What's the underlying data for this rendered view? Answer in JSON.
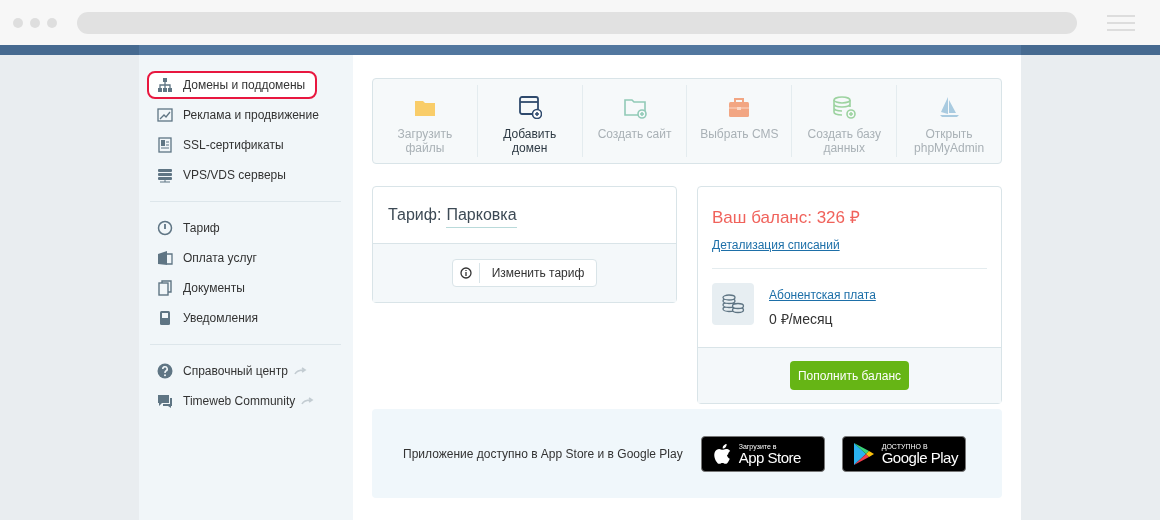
{
  "sidebar": {
    "groups": [
      {
        "items": [
          {
            "label": "Домены и поддомены",
            "kind": "sitemap",
            "selected": true,
            "highlighted": true,
            "external": false
          },
          {
            "label": "Реклама и продвижение",
            "kind": "chart",
            "selected": false,
            "highlighted": false,
            "external": false
          },
          {
            "label": "SSL-сертификаты",
            "kind": "certificate",
            "selected": false,
            "highlighted": false,
            "external": false
          },
          {
            "label": "VPS/VDS серверы",
            "kind": "server",
            "selected": false,
            "highlighted": false,
            "external": false
          }
        ]
      },
      {
        "items": [
          {
            "label": "Тариф",
            "kind": "gauge",
            "selected": false,
            "highlighted": false,
            "external": false
          },
          {
            "label": "Оплата услуг",
            "kind": "wallet",
            "selected": false,
            "highlighted": false,
            "external": false
          },
          {
            "label": "Документы",
            "kind": "documents",
            "selected": false,
            "highlighted": false,
            "external": false
          },
          {
            "label": "Уведомления",
            "kind": "phone",
            "selected": false,
            "highlighted": false,
            "external": false
          }
        ]
      },
      {
        "items": [
          {
            "label": "Справочный центр",
            "kind": "help",
            "selected": false,
            "highlighted": false,
            "external": true
          },
          {
            "label": "Timeweb Community",
            "kind": "chat",
            "selected": false,
            "highlighted": false,
            "external": true
          }
        ]
      }
    ]
  },
  "actions": [
    {
      "label": "Загрузить файлы",
      "kind": "folder",
      "disabled": true
    },
    {
      "label": "Добавить домен",
      "kind": "window",
      "disabled": false
    },
    {
      "label": "Создать сайт",
      "kind": "folderplus",
      "disabled": true
    },
    {
      "label": "Выбрать CMS",
      "kind": "briefcase",
      "disabled": true
    },
    {
      "label": "Создать базу данных",
      "kind": "database",
      "disabled": true
    },
    {
      "label": "Открыть phpMyAdmin",
      "kind": "sail",
      "disabled": true
    }
  ],
  "tariff": {
    "label": "Тариф:",
    "name": "Парковка",
    "button": "Изменить тариф"
  },
  "balance": {
    "title": "Ваш баланс: 326 ₽",
    "details_link": "Детализация списаний",
    "fee_link": "Абонентская плата",
    "fee_value": "0 ₽/месяц",
    "button": "Пополнить баланс"
  },
  "apps": {
    "text": "Приложение доступно в App Store и в Google Play",
    "badges": [
      {
        "kind": "apple",
        "small": "Загрузите в",
        "big": "App Store"
      },
      {
        "kind": "google",
        "small": "ДОСТУПНО В",
        "big": "Google Play"
      }
    ]
  }
}
